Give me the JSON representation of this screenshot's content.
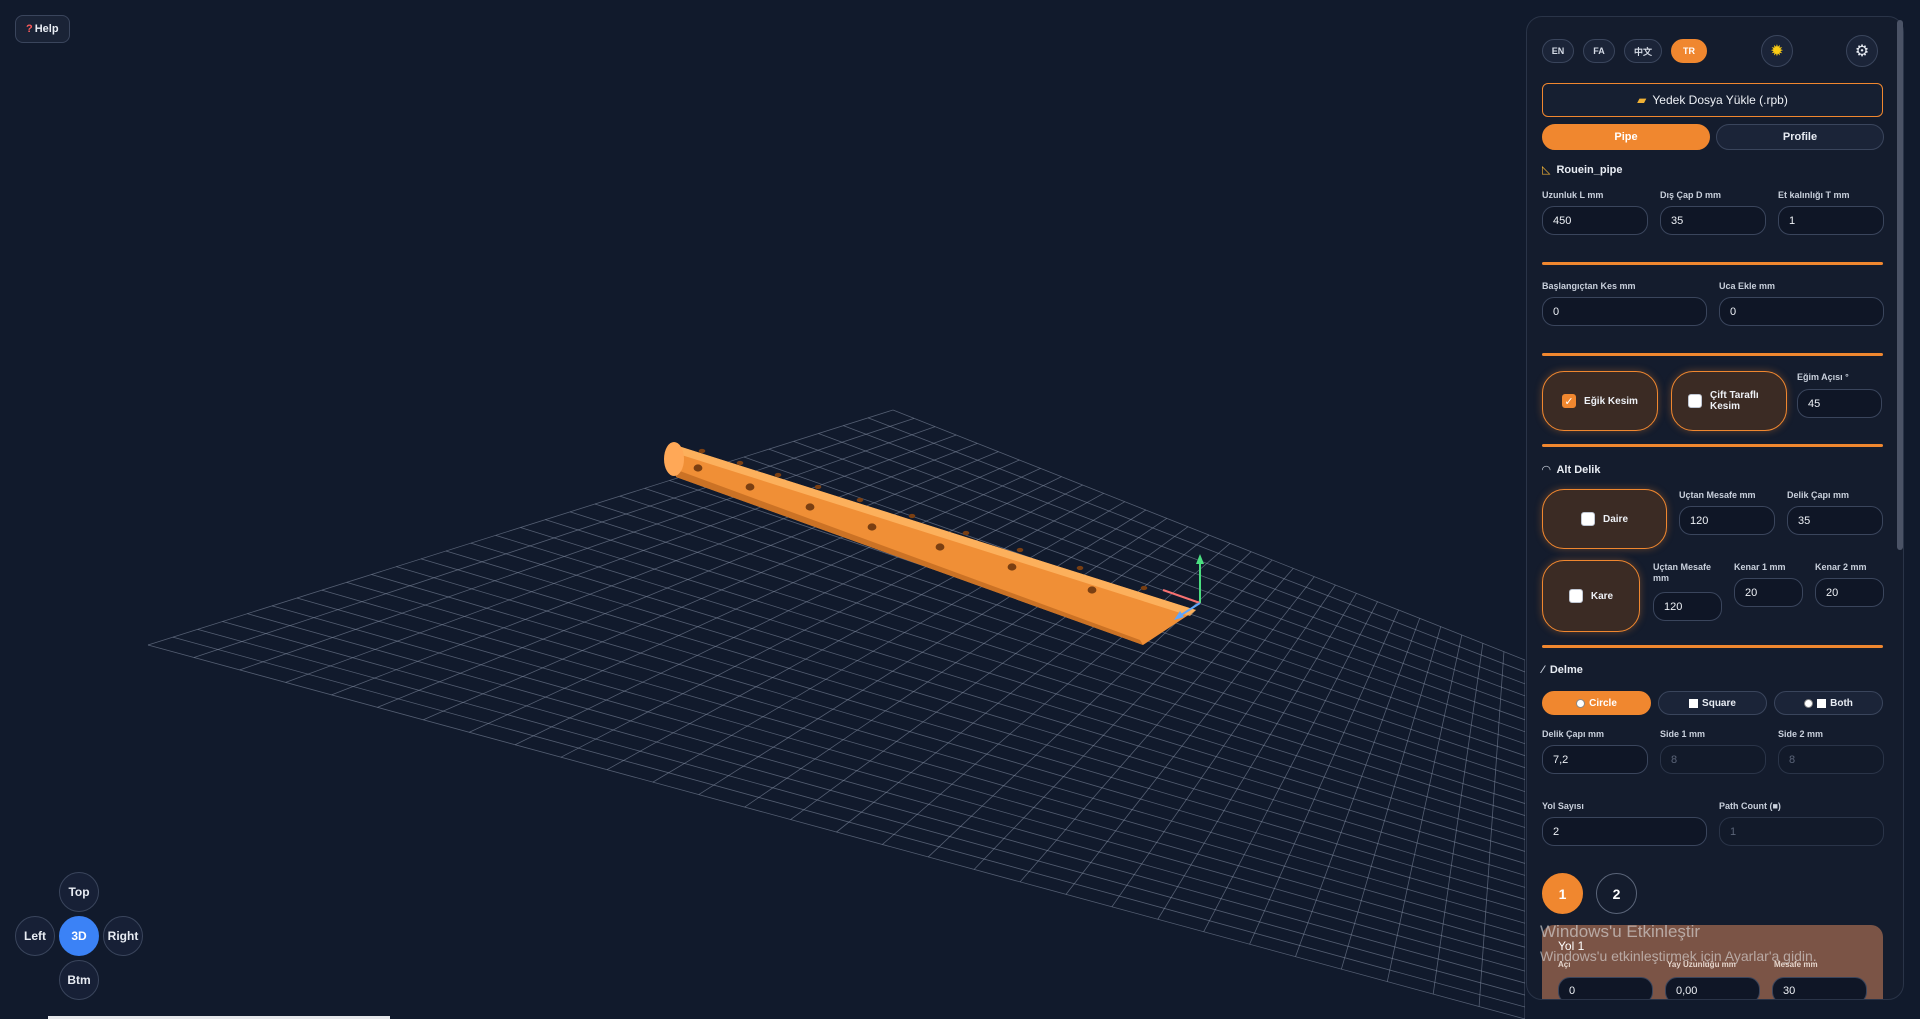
{
  "help": {
    "icon": "question-icon",
    "label": "Help"
  },
  "views": {
    "top": "Top",
    "left": "Left",
    "center": "3D",
    "right": "Right",
    "bottom": "Btm",
    "active": "3D"
  },
  "scene": {
    "pipe_color": "#f59a3c",
    "grid_color": "#8a95aa",
    "background": "#111a2c",
    "axis_colors": {
      "y": "#4ade80",
      "x": "#f87171",
      "z": "#60a5fa"
    }
  },
  "panel": {
    "languages": [
      "EN",
      "FA",
      "中文",
      "TR"
    ],
    "active_language": "TR",
    "theme_icon": "sun-icon",
    "settings_icon": "gear-icon",
    "load_icon": "folder-icon",
    "load_label": "Yedek Dosya Yükle (.rpb)",
    "tabs": [
      "Pipe",
      "Profile"
    ],
    "active_tab": "Pipe",
    "pipe": {
      "title": "Rouein_pipe",
      "title_icon": "ruler-icon",
      "length_label": "Uzunluk L mm",
      "length": "450",
      "od_label": "Dış Çap D mm",
      "od": "35",
      "wall_label": "Et kalınlığı T mm",
      "wall": "1"
    },
    "trim": {
      "start_label": "Başlangıçtan Kes mm",
      "start": "0",
      "end_label": "Uca Ekle mm",
      "end": "0"
    },
    "bevel": {
      "bevel_label": "Eğik Kesim",
      "bevel_checked": true,
      "double_label": "Çift Taraflı Kesim",
      "double_checked": false,
      "angle_label": "Eğim Açısı °",
      "angle": "45"
    },
    "bottom_hole": {
      "title": "Alt Delik",
      "title_icon": "arc-icon",
      "circle_label": "Daire",
      "circle_checked": false,
      "circle_dist_label": "Uçtan Mesafe mm",
      "circle_dist": "120",
      "circle_dia_label": "Delik Çapı mm",
      "circle_dia": "35",
      "square_label": "Kare",
      "square_checked": false,
      "square_dist_label": "Uçtan Mesafe mm",
      "square_dist": "120",
      "side1_label": "Kenar 1 mm",
      "side1": "20",
      "side2_label": "Kenar 2 mm",
      "side2": "20"
    },
    "drilling": {
      "title": "Delme",
      "title_icon": "pencil-icon",
      "modes": [
        "Circle",
        "Square",
        "Both"
      ],
      "active_mode": "Circle",
      "dia_label": "Delik Çapı mm",
      "dia": "7,2",
      "side1_label": "Side 1 mm",
      "side1": "8",
      "side2_label": "Side 2 mm",
      "side2": "8",
      "paths_label": "Yol Sayısı",
      "paths": "2",
      "path_count_label": "Path Count (■)",
      "path_count": "1",
      "path_buttons": [
        "1",
        "2"
      ],
      "active_path": "1"
    },
    "path1": {
      "title": "Yol 1",
      "angle_label": "Açı",
      "angle": "0",
      "length_label": "Yay Uzunluğu mm",
      "length": "0,00",
      "spacing_label": "Mesafe mm",
      "spacing": "30"
    }
  },
  "watermark": {
    "line1": "Windows'u Etkinleştir",
    "line2": "Windows'u etkinleştirmek için Ayarlar'a gidin."
  }
}
